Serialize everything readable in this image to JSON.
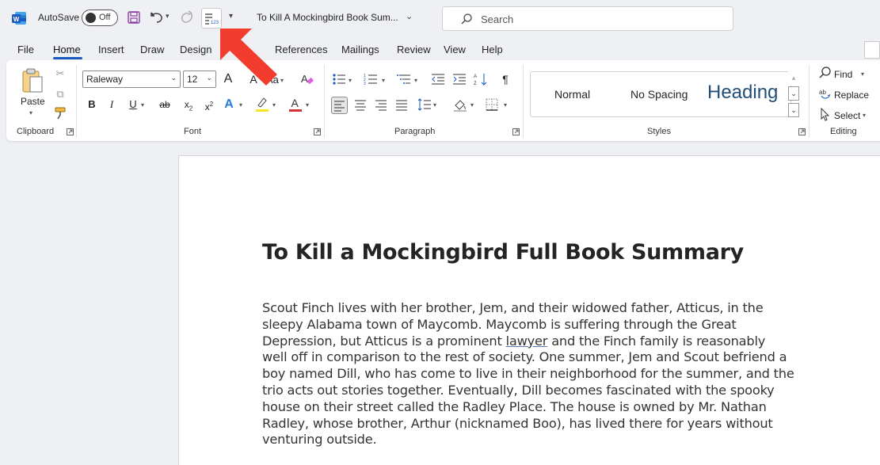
{
  "titlebar": {
    "autosave_label": "AutoSave",
    "autosave_state": "Off",
    "doc_title": "To Kill A Mockingbird Book Sum...",
    "search_placeholder": "Search"
  },
  "tabs": [
    {
      "label": "File"
    },
    {
      "label": "Home",
      "active": true
    },
    {
      "label": "Insert"
    },
    {
      "label": "Draw"
    },
    {
      "label": "Design"
    },
    {
      "label": "References"
    },
    {
      "label": "Mailings"
    },
    {
      "label": "Review"
    },
    {
      "label": "View"
    },
    {
      "label": "Help"
    }
  ],
  "ribbon": {
    "clipboard": {
      "group_label": "Clipboard",
      "paste_label": "Paste"
    },
    "font": {
      "group_label": "Font",
      "font_name": "Raleway",
      "font_size": "12",
      "change_case": "Aa"
    },
    "paragraph": {
      "group_label": "Paragraph"
    },
    "styles": {
      "group_label": "Styles",
      "normal": "Normal",
      "no_spacing": "No Spacing",
      "heading": "Heading"
    },
    "editing": {
      "group_label": "Editing",
      "find": "Find",
      "replace": "Replace",
      "select": "Select"
    }
  },
  "document": {
    "heading": "To Kill a Mockingbird Full Book Summary",
    "body_lines": [
      "Scout Finch lives with her brother, Jem, and their widowed father, Atticus, in the",
      "sleepy Alabama town of Maycomb. Maycomb is suffering through the Great",
      "Depression, but Atticus is a prominent ",
      "well off in comparison to the rest of society. One summer, Jem and Scout befriend a",
      "boy named Dill, who has come to live in their neighborhood for the summer, and the",
      "trio acts out stories together. Eventually, Dill becomes fascinated with the spooky",
      "house on their street called the Radley Place. The house is owned by Mr. Nathan",
      "Radley, whose brother, Arthur (nicknamed Boo), has lived there for years without",
      "venturing outside."
    ],
    "link_word": "lawyer",
    "line3_tail": " and the Finch family is reasonably"
  },
  "colors": {
    "accent": "#185abd",
    "arrow": "#f23c2e",
    "word_brand": "#185abd"
  }
}
